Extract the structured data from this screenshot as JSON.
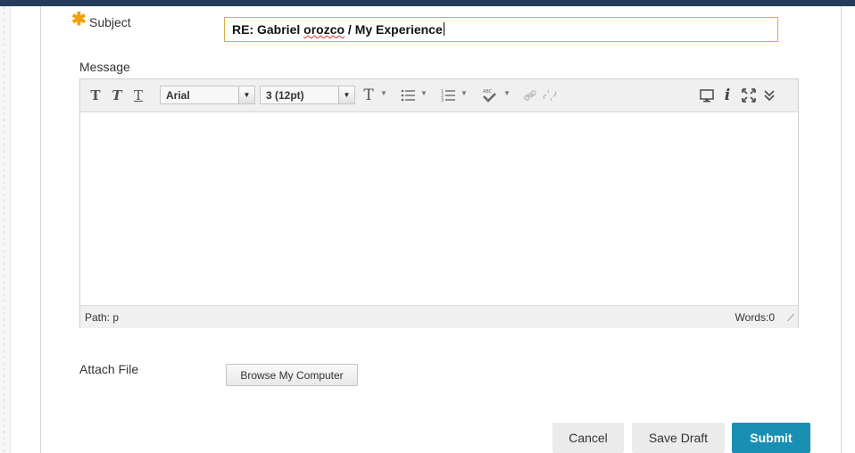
{
  "form": {
    "subject_label": "Subject",
    "subject_value_prefix": "RE: Gabriel ",
    "subject_value_misspelled": "orozco",
    "subject_value_suffix": " / My Experience",
    "message_label": "Message",
    "attach_label": "Attach File",
    "browse_label": "Browse My Computer"
  },
  "toolbar": {
    "font_family": "Arial",
    "font_size": "3 (12pt)"
  },
  "status": {
    "path_label": "Path: p",
    "words_label": "Words:0"
  },
  "actions": {
    "cancel_label": "Cancel",
    "save_draft_label": "Save Draft",
    "submit_label": "Submit"
  },
  "colors": {
    "required_star": "#f2a007",
    "submit_bg": "#1a8fb4",
    "top_bar": "#243e5a",
    "subject_border": "#e0a64a"
  },
  "icons": {
    "required": "asterisk-icon",
    "bold": "bold-text-icon",
    "italic": "italic-text-icon",
    "underline": "underline-text-icon",
    "text_color": "text-color-icon",
    "bullet_list": "bullet-list-icon",
    "numbered_list": "numbered-list-icon",
    "spellcheck": "spellcheck-icon",
    "link": "link-icon",
    "unlink": "unlink-icon",
    "preview": "preview-monitor-icon",
    "info": "info-icon",
    "fullscreen": "fullscreen-icon",
    "more": "double-chevron-down-icon",
    "resize": "resize-grip-icon"
  }
}
